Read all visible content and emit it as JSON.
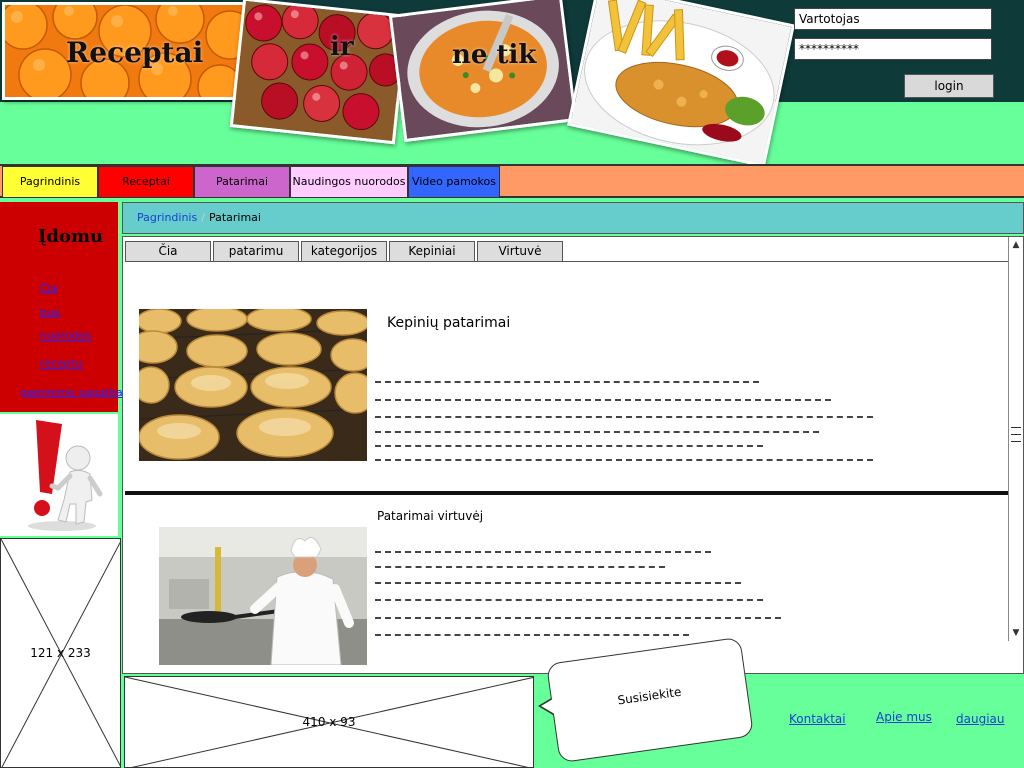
{
  "header": {
    "title_words": [
      "Receptai",
      "ir",
      "ne tik"
    ],
    "username_value": "Vartotojas",
    "password_value": "**********",
    "login_label": "login",
    "colors": {
      "bar": "#0f3a3a",
      "page_bg": "#66ff99"
    }
  },
  "nav": {
    "tabs": [
      {
        "label": "Pagrindinis",
        "color": "#ffff33"
      },
      {
        "label": "Receptai",
        "color": "#ff0000"
      },
      {
        "label": "Patarimai",
        "color": "#cc66cc"
      },
      {
        "label": "Naudingos nuorodos",
        "color": "#ffccff"
      },
      {
        "label": "Video pamokos",
        "color": "#3366ff"
      }
    ],
    "bar_color": "#ff9966"
  },
  "sidebar": {
    "title": "Įdomu",
    "links": [
      "Čia",
      "bus",
      "nuorodos",
      "receptu",
      "gaminimo pagalba"
    ],
    "placeholder_label": "121 x 233",
    "color": "#cc0000"
  },
  "breadcrumb": {
    "home": "Pagrindinis",
    "separator": "/",
    "current": "Patarimai"
  },
  "content": {
    "subtabs": [
      "Čia",
      "patarimu",
      "kategorijos",
      "Kepiniai",
      "Virtuvė"
    ],
    "articles": [
      {
        "title": "Kepinių patarimai",
        "image": "cookies-photo"
      },
      {
        "title": "Patarimai virtuvėj",
        "image": "chef-photo"
      }
    ]
  },
  "footer": {
    "placeholder_label": "410 x 93",
    "contact_label": "Susisiekite",
    "links": [
      "Kontaktai",
      "Apie mus",
      "daugiau"
    ]
  }
}
